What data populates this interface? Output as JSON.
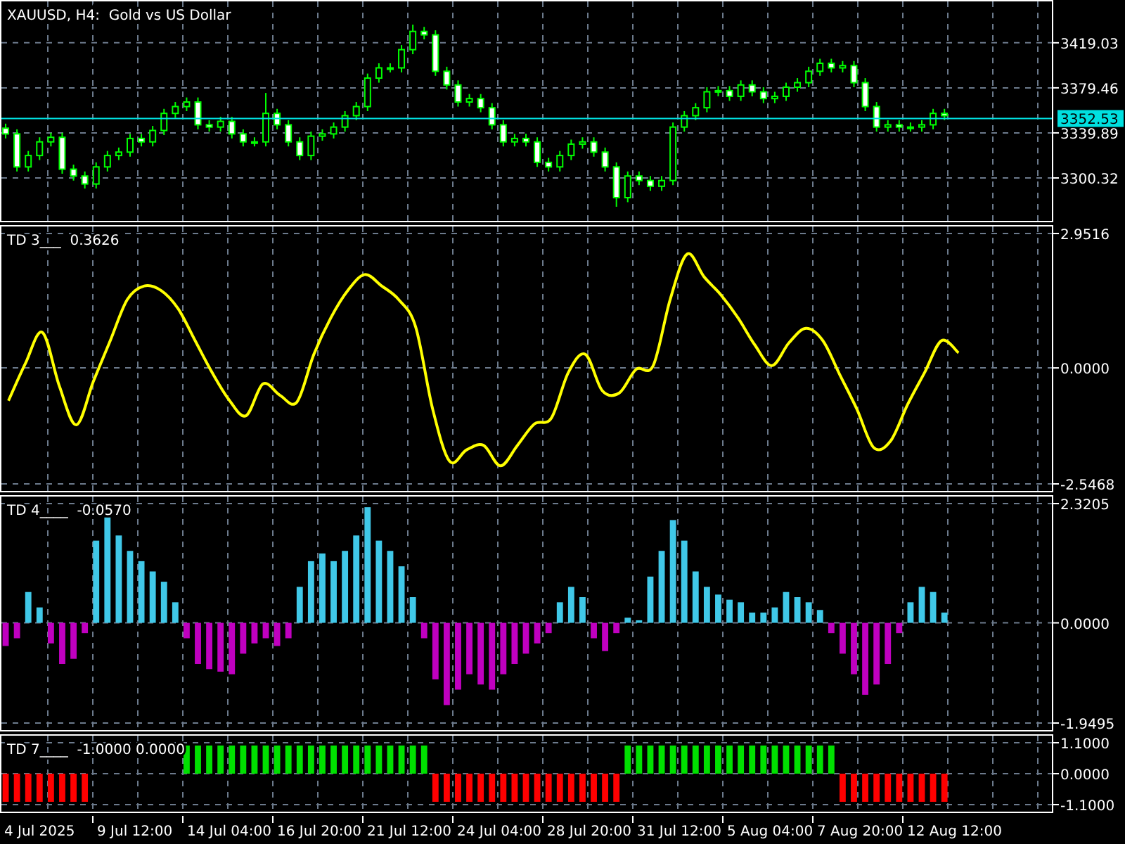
{
  "panels": [
    {
      "label": "XAUUSD, H4:  Gold vs US Dollar",
      "chart_data": {
        "type": "candlestick",
        "grid": true,
        "ylim": [
          3262,
          3456
        ],
        "ref_lines": [
          {
            "axis": "y",
            "value": 3352.53,
            "label": "3352.53",
            "color": "#00e0e0"
          }
        ],
        "yticks": [
          {
            "value": 3419.03,
            "label": "3419.03"
          },
          {
            "value": 3379.46,
            "label": "3379.46"
          },
          {
            "value": 3339.89,
            "label": "3339.89"
          },
          {
            "value": 3300.32,
            "label": "3300.32"
          }
        ],
        "ohlc": [
          [
            3344,
            3348,
            3335,
            3339
          ],
          [
            3339,
            3343,
            3306,
            3310
          ],
          [
            3310,
            3324,
            3306,
            3320
          ],
          [
            3320,
            3336,
            3316,
            3332
          ],
          [
            3332,
            3340,
            3328,
            3336
          ],
          [
            3336,
            3340,
            3304,
            3308
          ],
          [
            3308,
            3312,
            3298,
            3302
          ],
          [
            3302,
            3306,
            3291,
            3295
          ],
          [
            3295,
            3314,
            3291,
            3310
          ],
          [
            3310,
            3324,
            3306,
            3320
          ],
          [
            3320,
            3327,
            3316,
            3323
          ],
          [
            3323,
            3339,
            3319,
            3335
          ],
          [
            3335,
            3339,
            3328,
            3332
          ],
          [
            3332,
            3346,
            3328,
            3342
          ],
          [
            3342,
            3361,
            3338,
            3357
          ],
          [
            3357,
            3367,
            3353,
            3363
          ],
          [
            3363,
            3371,
            3359,
            3367
          ],
          [
            3367,
            3371,
            3343,
            3347
          ],
          [
            3347,
            3351,
            3341,
            3345
          ],
          [
            3345,
            3354,
            3341,
            3350
          ],
          [
            3350,
            3354,
            3335,
            3339
          ],
          [
            3339,
            3343,
            3328,
            3332
          ],
          [
            3332,
            3336,
            3328,
            3332
          ],
          [
            3332,
            3375,
            3328,
            3357
          ],
          [
            3357,
            3361,
            3343,
            3347
          ],
          [
            3347,
            3351,
            3328,
            3332
          ],
          [
            3332,
            3336,
            3316,
            3320
          ],
          [
            3320,
            3341,
            3316,
            3337
          ],
          [
            3337,
            3343,
            3333,
            3339
          ],
          [
            3339,
            3349,
            3335,
            3345
          ],
          [
            3345,
            3359,
            3341,
            3355
          ],
          [
            3355,
            3367,
            3351,
            3363
          ],
          [
            3363,
            3392,
            3359,
            3388
          ],
          [
            3388,
            3401,
            3384,
            3397
          ],
          [
            3397,
            3401,
            3393,
            3397
          ],
          [
            3397,
            3417,
            3393,
            3413
          ],
          [
            3413,
            3435,
            3409,
            3429
          ],
          [
            3429,
            3433,
            3422,
            3426
          ],
          [
            3426,
            3430,
            3390,
            3394
          ],
          [
            3394,
            3398,
            3378,
            3382
          ],
          [
            3382,
            3386,
            3363,
            3367
          ],
          [
            3367,
            3374,
            3363,
            3370
          ],
          [
            3370,
            3374,
            3358,
            3362
          ],
          [
            3362,
            3366,
            3343,
            3347
          ],
          [
            3347,
            3351,
            3328,
            3332
          ],
          [
            3332,
            3339,
            3328,
            3335
          ],
          [
            3335,
            3339,
            3328,
            3332
          ],
          [
            3332,
            3336,
            3310,
            3314
          ],
          [
            3314,
            3318,
            3306,
            3310
          ],
          [
            3310,
            3324,
            3306,
            3320
          ],
          [
            3320,
            3334,
            3316,
            3330
          ],
          [
            3330,
            3336,
            3326,
            3332
          ],
          [
            3332,
            3336,
            3319,
            3323
          ],
          [
            3323,
            3327,
            3306,
            3310
          ],
          [
            3310,
            3314,
            3275,
            3283
          ],
          [
            3283,
            3306,
            3279,
            3302
          ],
          [
            3302,
            3306,
            3294,
            3298
          ],
          [
            3298,
            3302,
            3289,
            3293
          ],
          [
            3293,
            3302,
            3289,
            3298
          ],
          [
            3298,
            3349,
            3294,
            3345
          ],
          [
            3345,
            3359,
            3341,
            3355
          ],
          [
            3355,
            3366,
            3351,
            3362
          ],
          [
            3362,
            3380,
            3358,
            3376
          ],
          [
            3376,
            3381,
            3372,
            3377
          ],
          [
            3377,
            3381,
            3368,
            3372
          ],
          [
            3372,
            3386,
            3368,
            3382
          ],
          [
            3382,
            3386,
            3372,
            3376
          ],
          [
            3376,
            3380,
            3366,
            3370
          ],
          [
            3370,
            3376,
            3366,
            3372
          ],
          [
            3372,
            3384,
            3368,
            3380
          ],
          [
            3380,
            3388,
            3376,
            3384
          ],
          [
            3384,
            3398,
            3380,
            3394
          ],
          [
            3394,
            3405,
            3390,
            3401
          ],
          [
            3401,
            3405,
            3393,
            3397
          ],
          [
            3397,
            3403,
            3393,
            3399
          ],
          [
            3399,
            3403,
            3380,
            3384
          ],
          [
            3384,
            3388,
            3359,
            3363
          ],
          [
            3363,
            3367,
            3341,
            3345
          ],
          [
            3345,
            3351,
            3341,
            3347
          ],
          [
            3347,
            3351,
            3341,
            3345
          ],
          [
            3345,
            3349,
            3341,
            3345
          ],
          [
            3345,
            3351,
            3341,
            3347
          ],
          [
            3347,
            3361,
            3343,
            3357
          ],
          [
            3357,
            3361,
            3351,
            3355
          ],
          null,
          null,
          null,
          null,
          null,
          null,
          null,
          null,
          null
        ]
      }
    },
    {
      "label": "TD 3___  0.3626",
      "chart_data": {
        "type": "line",
        "grid": true,
        "ylim": [
          -2.7167,
          3.1215
        ],
        "yticks": [
          {
            "value": 2.9516,
            "label": "2.9516"
          },
          {
            "value": 0,
            "label": "0.0000"
          },
          {
            "value": -2.5468,
            "label": "-2.5468"
          }
        ],
        "series": [
          {
            "color": "#ffff00",
            "values": [
              -0.72,
              0.1,
              0.78,
              -0.4,
              -1.25,
              -0.3,
              0.6,
              1.5,
              1.8,
              1.7,
              1.3,
              0.6,
              -0.1,
              -0.7,
              -1.05,
              -0.35,
              -0.6,
              -0.75,
              0.3,
              1.1,
              1.7,
              2.05,
              1.8,
              1.5,
              0.9,
              -0.9,
              -2.05,
              -1.8,
              -1.7,
              -2.15,
              -1.7,
              -1.23,
              -1.1,
              -0.1,
              0.3,
              -0.5,
              -0.55,
              -0.03,
              0.05,
              1.5,
              2.5,
              2.0,
              1.6,
              1.1,
              0.5,
              0.05,
              0.55,
              0.87,
              0.6,
              -0.15,
              -0.9,
              -1.75,
              -1.6,
              -0.8,
              -0.1,
              0.6,
              0.33,
              null,
              null,
              null,
              null,
              null
            ]
          }
        ]
      }
    },
    {
      "label": "TD 4____  -0.0570",
      "chart_data": {
        "type": "bar",
        "stacked": true,
        "grid": true,
        "ylim": [
          -2.1,
          2.471
        ],
        "yticks": [
          {
            "value": 2.3205,
            "label": "2.3205"
          },
          {
            "value": 0,
            "label": "0.0000"
          },
          {
            "value": -1.9495,
            "label": "-1.9495"
          }
        ],
        "series": [
          {
            "color": "#40c8e8",
            "values": [
              null,
              null,
              0.6,
              0.3,
              null,
              null,
              null,
              null,
              1.6,
              2.05,
              1.7,
              1.4,
              1.2,
              1.0,
              0.8,
              0.4,
              null,
              null,
              null,
              null,
              null,
              null,
              null,
              null,
              null,
              null,
              0.7,
              1.2,
              1.35,
              1.2,
              1.4,
              1.7,
              2.25,
              1.6,
              1.4,
              1.1,
              0.5,
              null,
              null,
              null,
              null,
              null,
              null,
              null,
              null,
              null,
              null,
              null,
              null,
              0.4,
              0.7,
              0.5,
              null,
              null,
              null,
              0.1,
              0.05,
              0.9,
              1.4,
              2.0,
              1.6,
              1.0,
              0.7,
              0.55,
              0.45,
              0.4,
              0.2,
              0.2,
              0.3,
              0.6,
              0.5,
              0.4,
              0.25,
              null,
              null,
              null,
              null,
              null,
              null,
              null,
              0.4,
              0.7,
              0.6,
              0.2,
              null,
              null,
              null,
              null,
              null,
              null,
              null,
              null,
              null
            ]
          },
          {
            "color": "#c000c0",
            "values": [
              -0.45,
              -0.3,
              null,
              null,
              -0.4,
              -0.8,
              -0.7,
              -0.2,
              null,
              null,
              null,
              null,
              null,
              null,
              null,
              null,
              -0.3,
              -0.8,
              -0.9,
              -0.95,
              -1.0,
              -0.6,
              -0.4,
              -0.3,
              -0.45,
              -0.3,
              null,
              null,
              null,
              null,
              null,
              null,
              null,
              null,
              null,
              null,
              null,
              -0.3,
              -1.1,
              -1.6,
              -1.3,
              -1.0,
              -1.2,
              -1.3,
              -1.0,
              -0.8,
              -0.6,
              -0.4,
              -0.2,
              null,
              null,
              null,
              -0.3,
              -0.55,
              -0.2,
              null,
              null,
              null,
              null,
              null,
              null,
              null,
              null,
              null,
              null,
              null,
              null,
              null,
              null,
              null,
              null,
              null,
              null,
              -0.2,
              -0.6,
              -1.0,
              -1.4,
              -1.2,
              -0.8,
              -0.2,
              null,
              null,
              null,
              null,
              null,
              null,
              null,
              null,
              null,
              null,
              null,
              null,
              null
            ]
          }
        ]
      }
    },
    {
      "label": "TD 7____  -1.0000 0.0000",
      "chart_data": {
        "type": "bar",
        "stacked": true,
        "grid": true,
        "ylim": [
          -1.375,
          1.375
        ],
        "yticks": [
          {
            "value": 1.1,
            "label": "1.1000"
          },
          {
            "value": 0,
            "label": "0.0000"
          },
          {
            "value": -1.1,
            "label": "-1.1000"
          }
        ],
        "series": [
          {
            "color": "#00e000",
            "values": [
              null,
              null,
              null,
              null,
              null,
              null,
              null,
              null,
              null,
              null,
              null,
              null,
              null,
              null,
              null,
              null,
              1,
              1,
              1,
              1,
              1,
              1,
              1,
              1,
              1,
              1,
              1,
              1,
              1,
              1,
              1,
              1,
              1,
              1,
              1,
              1,
              1,
              1,
              null,
              null,
              null,
              null,
              null,
              null,
              null,
              null,
              null,
              null,
              null,
              null,
              null,
              null,
              null,
              null,
              null,
              1,
              1,
              1,
              1,
              1,
              1,
              1,
              1,
              1,
              1,
              1,
              1,
              1,
              1,
              1,
              1,
              1,
              1,
              1,
              null,
              null,
              null,
              null,
              null,
              null,
              null,
              null,
              null,
              null,
              null,
              null,
              null,
              null,
              null,
              null,
              null,
              null,
              null
            ]
          },
          {
            "color": "#ff0000",
            "values": [
              -1,
              -1,
              -1,
              -1,
              -1,
              -1,
              -1,
              -1,
              null,
              null,
              null,
              null,
              null,
              null,
              null,
              null,
              null,
              null,
              null,
              null,
              null,
              null,
              null,
              null,
              null,
              null,
              null,
              null,
              null,
              null,
              null,
              null,
              null,
              null,
              null,
              null,
              null,
              null,
              -1,
              -1,
              -1,
              -1,
              -1,
              -1,
              -1,
              -1,
              -1,
              -1,
              -1,
              -1,
              -1,
              -1,
              -1,
              -1,
              -1,
              null,
              null,
              null,
              null,
              null,
              null,
              null,
              null,
              null,
              null,
              null,
              null,
              null,
              null,
              null,
              null,
              null,
              null,
              null,
              -1,
              -1,
              -1,
              -1,
              -1,
              -1,
              -1,
              -1,
              -1,
              -1,
              null,
              null,
              null,
              null,
              null,
              null,
              null,
              null,
              null
            ]
          }
        ]
      }
    }
  ],
  "time_axis": [
    "4 Jul 2025",
    "9 Jul 12:00",
    "14 Jul 04:00",
    "16 Jul 20:00",
    "21 Jul 12:00",
    "24 Jul 04:00",
    "28 Jul 20:00",
    "31 Jul 12:00",
    "5 Aug 04:00",
    "7 Aug 20:00",
    "12 Aug 12:00"
  ]
}
